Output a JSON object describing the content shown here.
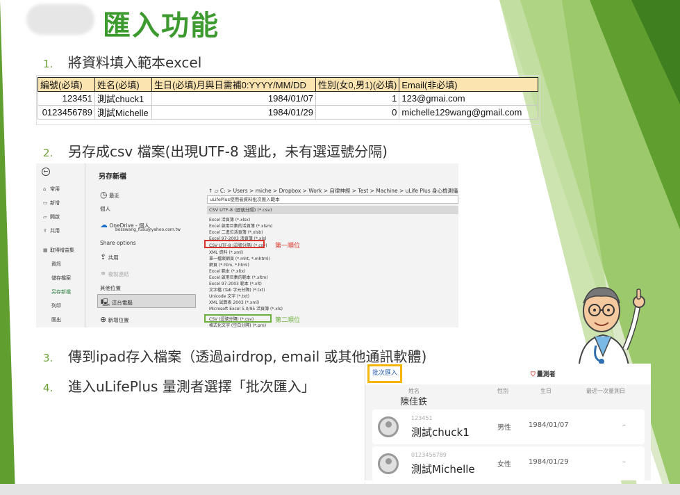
{
  "slide": {
    "title": "匯入功能",
    "steps": [
      {
        "num": "1.",
        "text": "將資料填入範本excel"
      },
      {
        "num": "2.",
        "text": "另存成csv 檔案(出現UTF-8 選此，未有選逗號分隔)"
      },
      {
        "num": "3.",
        "text": "傳到ipad存入檔案（透過airdrop, email 或其他通訊軟體)"
      },
      {
        "num": "4.",
        "text": "進入uLifePlus 量測者選擇「批次匯入」"
      }
    ]
  },
  "excel": {
    "headers": [
      "編號(必填)",
      "姓名(必填)",
      "生日(必填)月與日需補0:YYYY/MM/DD",
      "性別(女0,男1)(必填)",
      "Email(非必填)"
    ],
    "rows": [
      [
        "123451",
        "測試chuck1",
        "1984/01/07",
        "1",
        "123@gmai.com"
      ],
      [
        "0123456789",
        "測試Michelle",
        "1984/01/29",
        "0",
        "michelle129wang@gmail.com"
      ]
    ]
  },
  "save_dialog": {
    "title": "另存新檔",
    "nav": [
      "常用",
      "新增",
      "開啟",
      "共用",
      "取得增益集",
      "資訊",
      "儲存檔案",
      "另存新檔",
      "列印",
      "匯出"
    ],
    "recent": "最近",
    "personal": "個人",
    "onedrive": "OneDrive - 個人",
    "email": "bosswang_fusu@yahoo.com.tw",
    "share_options": "Share options",
    "share": "共用",
    "copy_link": "複製連結",
    "other_locations": "其他位置",
    "this_pc": "這台電腦",
    "add_location": "新增位置",
    "path": "C: > Users > miche > Dropbox > Work > 自律神經 > Test > Machine > uLife Plus 身心檢測儀 >",
    "filename": "uLifePlus使用者資料批次匯入範本",
    "selected_type": "CSV UTF-8 (逗號分隔) (*.csv)",
    "types": [
      "Excel 活頁簿 (*.xlsx)",
      "Excel 啟用巨集的活頁簿 (*.xlsm)",
      "Excel 二進位活頁簿 (*.xlsb)",
      "Excel 97-2003 活頁簿 (*.xls)",
      "CSV UTF-8 (逗號分隔) (*.csv)",
      "XML 資料 (*.xml)",
      "單一檔案網頁 (*.mht, *.mhtml)",
      "網頁 (*.htm, *.html)",
      "Excel 範本 (*.xltx)",
      "Excel 啟用巨集的範本 (*.xltm)",
      "Excel 97-2003 範本 (*.xlt)",
      "文字檔 (Tab 字元分隔) (*.txt)",
      "Unicode 文字 (*.txt)",
      "XML 試算表 2003 (*.xml)",
      "Microsoft Excel 5.0/95 活頁簿 (*.xls)",
      "CSV (逗號分隔) (*.csv)",
      "格式化文字 (空白分隔) (*.prn)"
    ],
    "first_option_label": "第一順位",
    "second_option_label": "第二順位"
  },
  "ipad": {
    "batch_import": "批次匯入",
    "measurer": "量測者",
    "columns": [
      "姓名",
      "性別",
      "生日",
      "最近一次量測日"
    ],
    "previous_name": "陳佳鉄",
    "rows": [
      {
        "id": "123451",
        "name": "測試chuck1",
        "gender": "男性",
        "birthday": "1984/01/07",
        "last": "–"
      },
      {
        "id": "0123456789",
        "name": "測試Michelle",
        "gender": "女性",
        "birthday": "1984/01/29",
        "last": "–"
      }
    ]
  },
  "colors": {
    "accent_green": "#3d9a2f",
    "highlight_red": "#d9342b",
    "highlight_yellow": "#f5b60a"
  }
}
